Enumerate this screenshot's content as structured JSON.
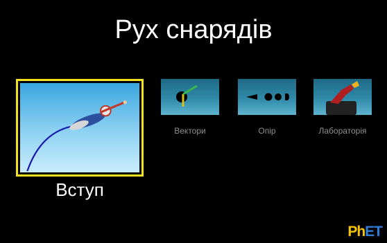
{
  "title": "Рух снарядів",
  "screens": [
    {
      "id": "intro",
      "label": "Вступ",
      "selected": true
    },
    {
      "id": "vectors",
      "label": "Вектори"
    },
    {
      "id": "drag",
      "label": "Опір"
    },
    {
      "id": "lab",
      "label": "Лабораторія"
    }
  ],
  "brand": {
    "p": "P",
    "h": "h",
    "e": "E",
    "t": "T"
  },
  "colors": {
    "selection": "#f2e21f",
    "label": "#8f8f8f",
    "brand_yellow": "#f5c400",
    "brand_blue": "#2f7dd6"
  }
}
